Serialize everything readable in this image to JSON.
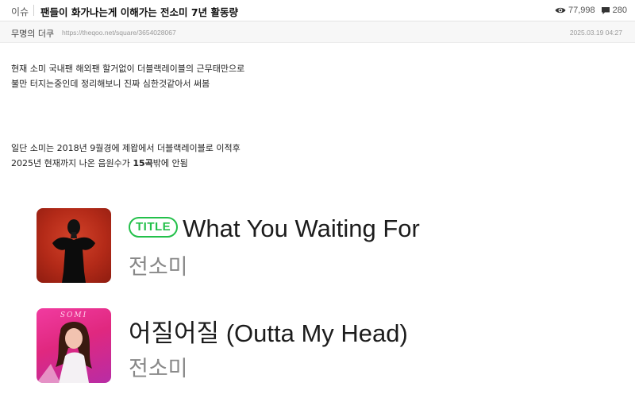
{
  "header": {
    "category": "이슈",
    "title": "팬들이 화가나는게 이해가는 전소미 7년 활동량",
    "views": "77,998",
    "comments": "280"
  },
  "meta": {
    "author": "무명의 더쿠",
    "url": "https://theqoo.net/square/3654028067",
    "date": "2025.03.19 04:27"
  },
  "content": {
    "para1": [
      "현재 소미 국내팬 해외팬 할거없이 더블랙레이블의 근무태만으로",
      "불만 터지는중인데 정리해보니 진짜 심한것같아서 써봄"
    ],
    "para2_line1": "일단 소미는 2018년 9월경에 제왑에서 더블랙레이블로 이적후",
    "para2_line2_before": "2025년 현재까지 나온 음원수가 ",
    "para2_line2_bold": "15곡",
    "para2_line2_after": "밖에 안됨"
  },
  "songs": [
    {
      "badge": "TITLE",
      "title": "What You Waiting For",
      "artist": "전소미"
    },
    {
      "title": "어질어질 (Outta My Head)",
      "artist": "전소미",
      "cover_text": "SOMI"
    }
  ],
  "colors": {
    "badge_green": "#23c04a",
    "cover1": "#c43320",
    "cover2": "#e8308c"
  },
  "icons": {
    "views": "eye-icon",
    "comments": "comment-icon"
  }
}
